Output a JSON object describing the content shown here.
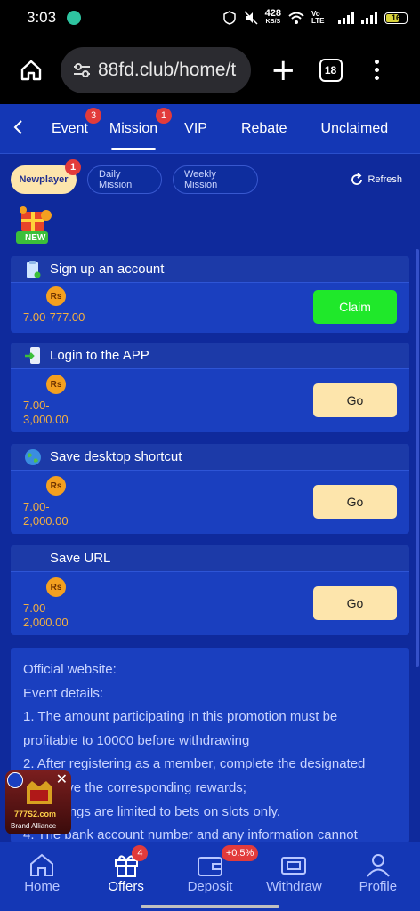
{
  "status": {
    "time": "3:03",
    "speed": "428",
    "speed_unit": "KB/S",
    "network": "Vo LTE",
    "battery": "16"
  },
  "browser": {
    "url": "88fd.club/home/t",
    "tab_count": "18"
  },
  "nav": {
    "tabs": [
      {
        "label": "Event",
        "badge": "3"
      },
      {
        "label": "Mission",
        "badge": "1"
      },
      {
        "label": "VIP"
      },
      {
        "label": "Rebate"
      },
      {
        "label": "Unclaimed"
      }
    ]
  },
  "subtabs": {
    "items": [
      {
        "label": "Newplayer",
        "badge": "1"
      },
      {
        "label": "Daily Mission"
      },
      {
        "label": "Weekly Mission"
      }
    ],
    "refresh_label": "Refresh",
    "new_badge": "NEW"
  },
  "missions": [
    {
      "title": "Sign up an account",
      "currency": "Rs",
      "reward": "7.00-777.00",
      "button": "Claim"
    },
    {
      "title": "Login to the APP",
      "currency": "Rs",
      "reward": "7.00-3,000.00",
      "button": "Go"
    },
    {
      "title": "Save desktop shortcut",
      "currency": "Rs",
      "reward": "7.00-2,000.00",
      "button": "Go"
    },
    {
      "title": "Save URL",
      "currency": "Rs",
      "reward": "7.00-2,000.00",
      "button": "Go"
    }
  ],
  "info": {
    "lines": [
      "Official website:",
      "Event details:",
      "1. The amount participating in this promotion must be",
      "profitable to 10000 before withdrawing",
      "2. After registering as a member, complete the designated",
      "to receive the corresponding rewards;",
      "3. Earnings are limited to bets on slots only.",
      "4. The bank account number and any information cannot"
    ]
  },
  "ad": {
    "brand": "777S2.com",
    "subtitle": "Brand Alliance"
  },
  "bottom_nav": [
    {
      "label": "Home"
    },
    {
      "label": "Offers",
      "badge": "4"
    },
    {
      "label": "Deposit",
      "badge": "+0.5%"
    },
    {
      "label": "Withdraw"
    },
    {
      "label": "Profile"
    }
  ]
}
